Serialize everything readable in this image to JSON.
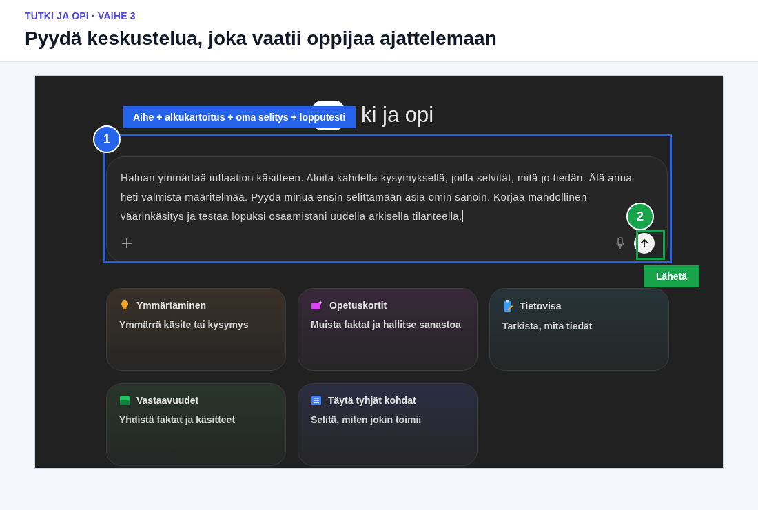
{
  "header": {
    "step": "TUTKI JA OPI · VAIHE 3",
    "title": "Pyydä keskustelua, joka vaatii oppijaa ajattelemaan"
  },
  "app": {
    "title": "ki ja opi",
    "composer": {
      "value": "Haluan ymmärtää inflaation käsitteen. Aloita kahdella kysymyksellä, joilla selvität, mitä jo tiedän. Älä anna heti valmista määritelmää. Pyydä minua ensin selittämään asia omin sanoin. Korjaa mahdollinen väärinkäsitys ja testaa lopuksi osaamistani uudella arkisella tilanteella."
    },
    "cards": [
      {
        "kind": "bulb",
        "color": "#3a3128",
        "title": "Ymmärtäminen",
        "subtitle": "Ymmärrä käsite tai kysymys"
      },
      {
        "kind": "flashcards",
        "color": "#38283a",
        "title": "Opetuskortit",
        "subtitle": "Muista faktat ja hallitse sanastoa"
      },
      {
        "kind": "quiz",
        "color": "#263439",
        "title": "Tietovisa",
        "subtitle": "Tarkista, mitä tiedät"
      },
      {
        "kind": "matching",
        "color": "#28352a",
        "title": "Vastaavuudet",
        "subtitle": "Yhdistä faktat ja käsitteet"
      },
      {
        "kind": "blanks",
        "color": "#2b2e42",
        "title": "Täytä tyhjät kohdat",
        "subtitle": "Selitä, miten jokin toimii"
      }
    ]
  },
  "callouts": {
    "prompt_label": "Aihe + alkukartoitus + oma selitys + lopputesti",
    "prompt_badge": "1",
    "send_badge": "2",
    "send_label": "Lähetä"
  }
}
